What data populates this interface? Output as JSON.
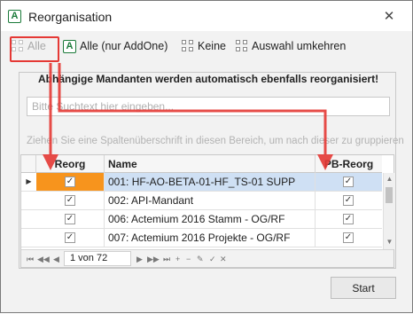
{
  "window": {
    "title": "Reorganisation",
    "app_icon": "A",
    "close_icon": "close-icon"
  },
  "toolbar": {
    "alle": "Alle",
    "alle_addone": "Alle (nur AddOne)",
    "keine": "Keine",
    "auswahl_umkehren": "Auswahl umkehren",
    "addone_icon_letter": "A"
  },
  "info_text": "Abhängige Mandanten werden automatisch ebenfalls reorganisiert!",
  "search": {
    "placeholder": "Bitte Suchtext hier eingeben..."
  },
  "group_hint": "Ziehen Sie eine Spaltenüberschrift in diesen Bereich, um nach dieser zu gruppieren",
  "table": {
    "columns": [
      "Reorg",
      "Name",
      "PB-Reorg"
    ],
    "rows": [
      {
        "reorg": true,
        "name": "001: HF-AO-BETA-01-HF_TS-01 SUPP",
        "pb_reorg": true,
        "selected": true
      },
      {
        "reorg": true,
        "name": "002: API-Mandant",
        "pb_reorg": true,
        "selected": false
      },
      {
        "reorg": true,
        "name": "006: Actemium 2016 Stamm - OG/RF",
        "pb_reorg": true,
        "selected": false
      },
      {
        "reorg": true,
        "name": "007: Actemium 2016  Projekte - OG/RF",
        "pb_reorg": true,
        "selected": false
      }
    ]
  },
  "pager": {
    "page_text": "1 von 72"
  },
  "buttons": {
    "start": "Start"
  },
  "colors": {
    "annotation_red": "#e53935",
    "selection_orange": "#f7941d",
    "selection_blue": "#cfe0f4",
    "brand_green": "#1b7a3a"
  }
}
